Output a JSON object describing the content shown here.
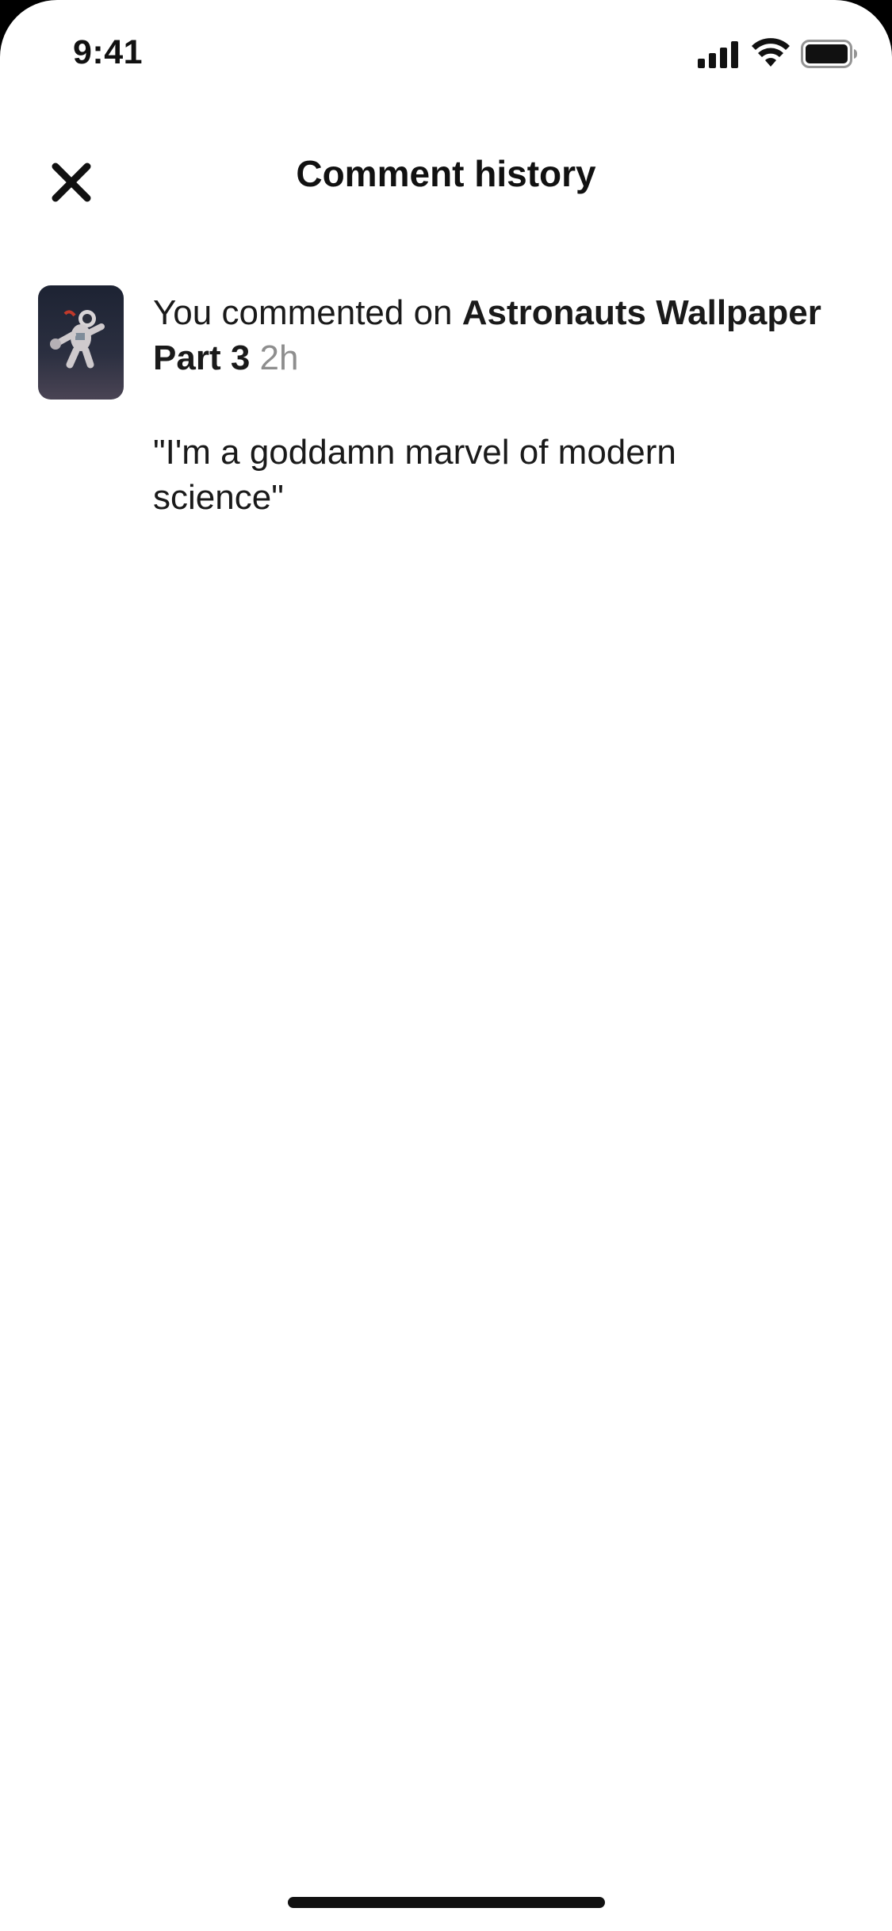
{
  "status_bar": {
    "time": "9:41",
    "icons": [
      "signal-icon",
      "wifi-icon",
      "battery-icon"
    ]
  },
  "header": {
    "title": "Comment history",
    "close_icon": "close-icon"
  },
  "comments": [
    {
      "prefix": "You commented on ",
      "pin_title": "Astronauts Wallpaper Part 3",
      "time_ago": "2h",
      "text": "\"I'm a goddamn marvel of modern science\"",
      "thumbnail_icon": "astronaut-thumbnail-image"
    }
  ],
  "colors": {
    "background": "#ffffff",
    "text": "#111111",
    "timestamp": "#8e8e8e"
  }
}
